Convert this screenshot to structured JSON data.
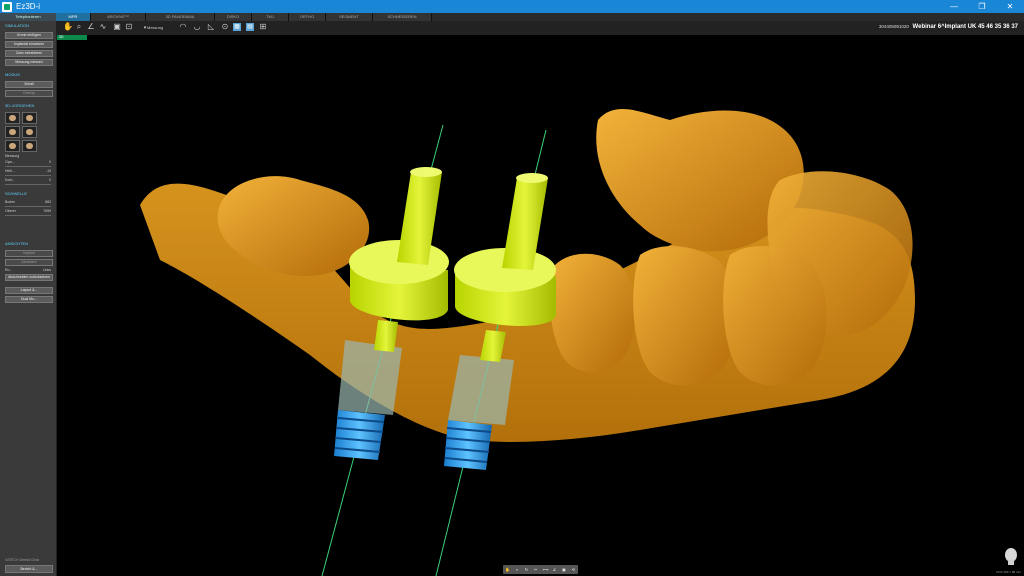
{
  "window": {
    "title": "Ez3D-i",
    "controls": [
      "—",
      "❐",
      "✕"
    ]
  },
  "tabbar": {
    "first": "Telephonieren",
    "tabs": [
      {
        "label": "MPR",
        "active": true
      },
      {
        "label": "ARCHIVE™",
        "active": false
      },
      {
        "label": "3D PANORAMA",
        "active": false
      },
      {
        "label": "DISKO",
        "active": false
      },
      {
        "label": "TMJ",
        "active": false
      },
      {
        "label": "ORTHO",
        "active": false
      },
      {
        "label": "SEGMENT",
        "active": false
      },
      {
        "label": "SCHNEIDEREN",
        "active": false
      }
    ]
  },
  "toolbar": {
    "measure_label": "Messung"
  },
  "patient": {
    "id": "304405081020",
    "name": "Webinar 6^Implant UK 45 46 35 36 37"
  },
  "view_tag": "3D",
  "sidebar": {
    "sections": {
      "simulation": {
        "title": "SIMULATION",
        "buttons": [
          "Krone einfügen",
          "Implantat einsetzen",
          "Zahn extrahieren",
          "Messung messen"
        ]
      },
      "modus": {
        "title": "MODUS",
        "buttons": [
          "Schall",
          "Overlay"
        ]
      },
      "view3d": {
        "title": "3D-VORGEHEN",
        "checkbox": "Messung"
      },
      "sliders": [
        {
          "label": "Opa...",
          "value": "0"
        },
        {
          "label": "Helli...",
          "value": "-19"
        },
        {
          "label": "Kont...",
          "value": "0"
        }
      ],
      "schwelle": {
        "title": "SCHWELLE",
        "rows": [
          {
            "label": "Boden",
            "value": "883"
          },
          {
            "label": "Oberer",
            "value": "7059"
          }
        ]
      },
      "ansicht": {
        "title": "ANSICHTEN",
        "buttons": [
          "Implant",
          "Abutment"
        ],
        "row": {
          "label": "Ro...",
          "value": "Links"
        },
        "extra_button": "Abschneiden zurücksetzen",
        "bottom_buttons": [
          "Layout &...",
          "Dual Mo..."
        ]
      }
    },
    "footer_text": "VATECH Dental Clinic",
    "footer_button": "Bericht &..."
  },
  "corner_info": "FOV 100 × 85 mm",
  "icons": {
    "bottom_bar": [
      "hand-icon",
      "zoom-icon",
      "rotate-icon",
      "cut-icon",
      "measure-icon",
      "angle-icon",
      "screenshot-icon",
      "reset-icon"
    ]
  }
}
